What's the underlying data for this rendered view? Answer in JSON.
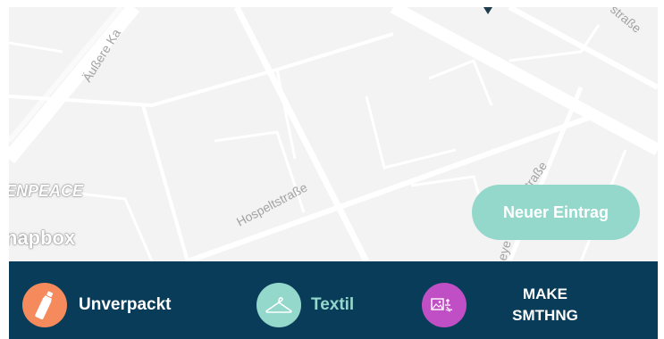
{
  "map": {
    "streets": [
      "Äußere Ka",
      "straße",
      "Hospeltstraße",
      "straße",
      "eye"
    ],
    "watermarks": {
      "greenpeace": "ENPEACE",
      "mapbox": "napbox"
    },
    "new_entry_label": "Neuer Eintrag",
    "colors": {
      "land": "#f3f3f3",
      "road": "#ffffff",
      "label": "#a3a3a3"
    }
  },
  "categories": [
    {
      "id": "unverpackt",
      "label": "Unverpackt",
      "icon": "bottle-icon",
      "color": "#f58a5c",
      "active": false
    },
    {
      "id": "textil",
      "label": "Textil",
      "icon": "hanger-icon",
      "color": "#94d8cc",
      "active": true
    },
    {
      "id": "make",
      "label_line1": "MAKE",
      "label_line2": "SMTHNG",
      "icon": "picture-brush-icon",
      "color": "#c04fc5",
      "active": false
    }
  ],
  "colors": {
    "bar": "#083c58",
    "accent": "#94d8cc",
    "text": "#ffffff"
  }
}
